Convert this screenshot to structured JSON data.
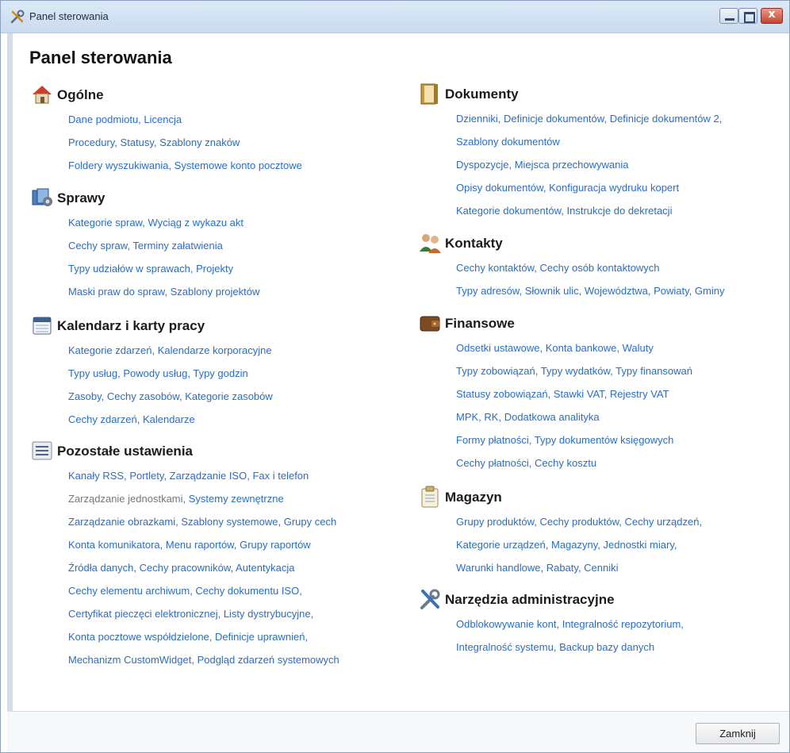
{
  "window": {
    "title": "Panel sterowania",
    "close_symbol": "x"
  },
  "page_title": "Panel sterowania",
  "footer": {
    "close_label": "Zamknij"
  },
  "colors": {
    "link": "#2a6ec0",
    "dim_link": "#777777"
  },
  "left_column": [
    {
      "title": "Ogólne",
      "icon": "house-icon",
      "lines": [
        [
          "Dane podmiotu",
          "Licencja"
        ],
        [
          "Procedury",
          "Statusy",
          "Szablony znaków"
        ],
        [
          "Foldery wyszukiwania",
          "Systemowe konto pocztowe"
        ]
      ]
    },
    {
      "title": "Sprawy",
      "icon": "cases-icon",
      "lines": [
        [
          "Kategorie spraw",
          "Wyciąg z wykazu akt"
        ],
        [
          "Cechy spraw",
          "Terminy załatwienia"
        ],
        [
          "Typy udziałów w sprawach",
          "Projekty"
        ],
        [
          "Maski praw do spraw",
          "Szablony projektów"
        ]
      ]
    },
    {
      "title": "Kalendarz i karty pracy",
      "icon": "calendar-icon",
      "lines": [
        [
          "Kategorie zdarzeń",
          "Kalendarze korporacyjne"
        ],
        [
          "Typy usług",
          "Powody usług",
          "Typy godzin"
        ],
        [
          "Zasoby",
          "Cechy zasobów",
          "Kategorie zasobów"
        ],
        [
          "Cechy zdarzeń",
          "Kalendarze"
        ]
      ]
    },
    {
      "title": "Pozostałe ustawienia",
      "icon": "settings-list-icon",
      "lines": [
        [
          "Kanały RSS",
          "Portlety",
          "Zarządzanie ISO",
          "Fax i telefon"
        ],
        [
          "Zarządzanie jednostkami",
          "Systemy zewnętrzne"
        ],
        [
          "Zarządzanie obrazkami",
          "Szablony systemowe",
          "Grupy cech"
        ],
        [
          "Konta komunikatora",
          "Menu raportów",
          "Grupy raportów"
        ],
        [
          "Źródła danych",
          "Cechy pracowników",
          "Autentykacja"
        ],
        [
          "Cechy elementu archiwum",
          "Cechy dokumentu ISO",
          ""
        ],
        [
          "Certyfikat pieczęci elektronicznej",
          "Listy dystrybucyjne",
          ""
        ],
        [
          "Konta pocztowe współdzielone",
          "Definicje uprawnień",
          ""
        ],
        [
          "Mechanizm CustomWidget",
          "Podgląd zdarzeń systemowych"
        ]
      ]
    }
  ],
  "right_column": [
    {
      "title": "Dokumenty",
      "icon": "book-icon",
      "lines": [
        [
          "Dzienniki",
          "Definicje dokumentów",
          "Definicje dokumentów 2",
          ""
        ],
        [
          "Szablony dokumentów"
        ],
        [
          "Dyspozycje",
          "Miejsca przechowywania"
        ],
        [
          "Opisy dokumentów",
          "Konfiguracja wydruku kopert"
        ],
        [
          "Kategorie dokumentów",
          "Instrukcje do dekretacji"
        ]
      ]
    },
    {
      "title": "Kontakty",
      "icon": "contacts-icon",
      "lines": [
        [
          "Cechy kontaktów",
          "Cechy osób kontaktowych"
        ],
        [
          "Typy adresów",
          "Słownik ulic",
          "Województwa",
          "Powiaty",
          "Gminy"
        ]
      ]
    },
    {
      "title": "Finansowe",
      "icon": "wallet-icon",
      "lines": [
        [
          "Odsetki ustawowe",
          "Konta bankowe",
          "Waluty"
        ],
        [
          "Typy zobowiązań",
          "Typy wydatków",
          "Typy finansowań"
        ],
        [
          "Statusy zobowiązań",
          "Stawki VAT",
          "Rejestry VAT"
        ],
        [
          "MPK",
          "RK",
          "Dodatkowa analityka"
        ],
        [
          "Formy płatności",
          "Typy dokumentów księgowych"
        ],
        [
          "Cechy płatności",
          "Cechy kosztu"
        ]
      ]
    },
    {
      "title": "Magazyn",
      "icon": "clipboard-icon",
      "lines": [
        [
          "Grupy produktów",
          "Cechy produktów",
          "Cechy urządzeń",
          ""
        ],
        [
          "Kategorie urządzeń",
          "Magazyny",
          "Jednostki miary",
          ""
        ],
        [
          "Warunki handlowe",
          "Rabaty",
          "Cenniki"
        ]
      ]
    },
    {
      "title": "Narzędzia administracyjne",
      "icon": "tools-icon",
      "lines": [
        [
          "Odblokowywanie kont",
          "Integralność repozytorium",
          ""
        ],
        [
          "Integralność systemu",
          "Backup bazy danych"
        ]
      ]
    }
  ]
}
